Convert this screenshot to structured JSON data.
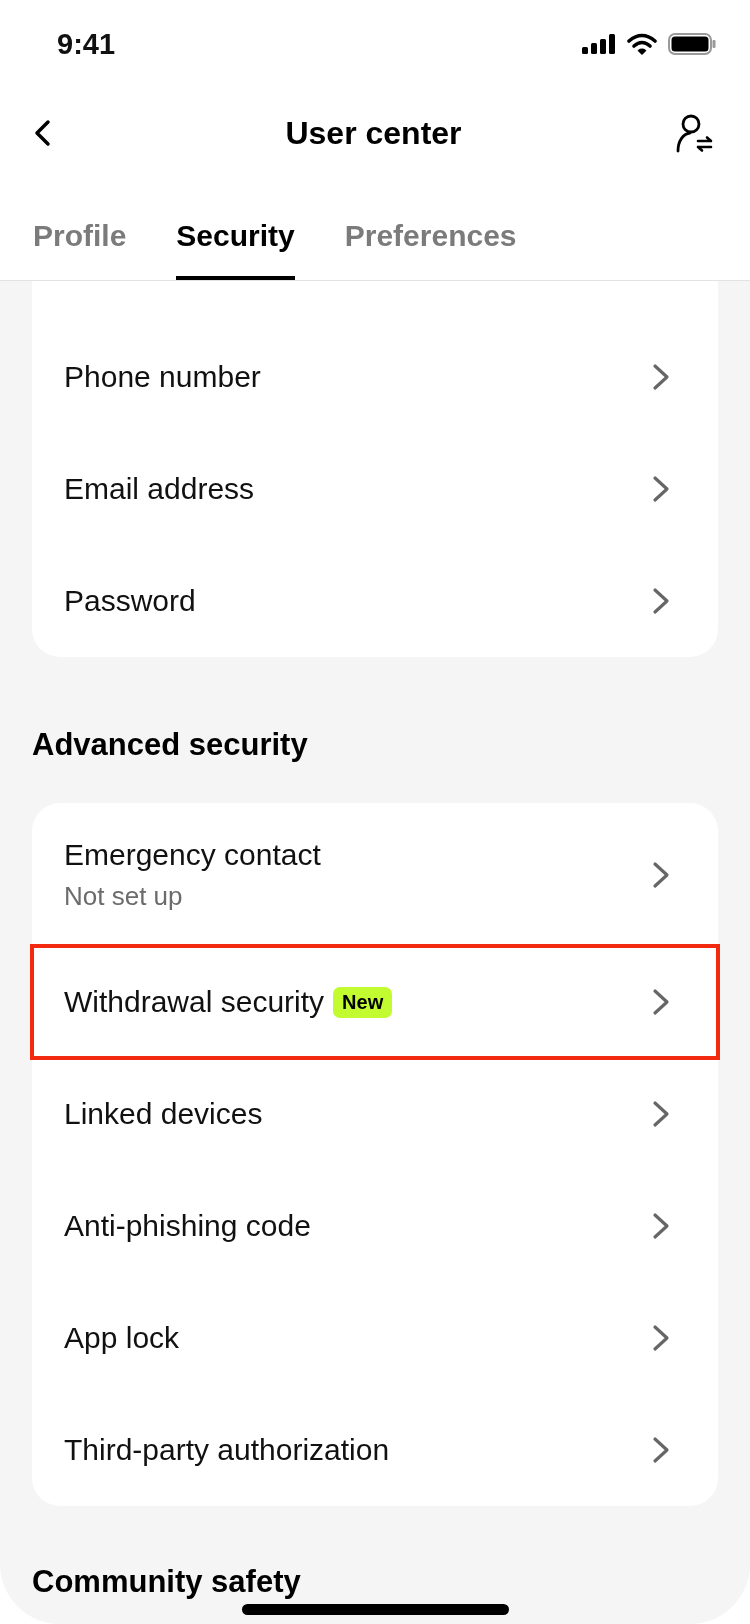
{
  "status_bar": {
    "time": "9:41"
  },
  "nav": {
    "title": "User center"
  },
  "tabs": [
    {
      "label": "Profile",
      "selected": false
    },
    {
      "label": "Security",
      "selected": true
    },
    {
      "label": "Preferences",
      "selected": false
    }
  ],
  "sections": [
    {
      "items": [
        {
          "label": "Phone number",
          "highlighted": false
        },
        {
          "label": "Email address",
          "highlighted": false
        },
        {
          "label": "Password",
          "highlighted": false
        }
      ]
    },
    {
      "title": "Advanced security",
      "items": [
        {
          "label": "Emergency contact",
          "subtitle": "Not set up",
          "highlighted": false
        },
        {
          "label": "Withdrawal security",
          "badge": "New",
          "highlighted": true
        },
        {
          "label": "Linked devices",
          "highlighted": false
        },
        {
          "label": "Anti-phishing code",
          "highlighted": false
        },
        {
          "label": "App lock",
          "highlighted": false
        },
        {
          "label": "Third-party authorization",
          "highlighted": false
        }
      ]
    },
    {
      "title": "Community safety"
    }
  ]
}
